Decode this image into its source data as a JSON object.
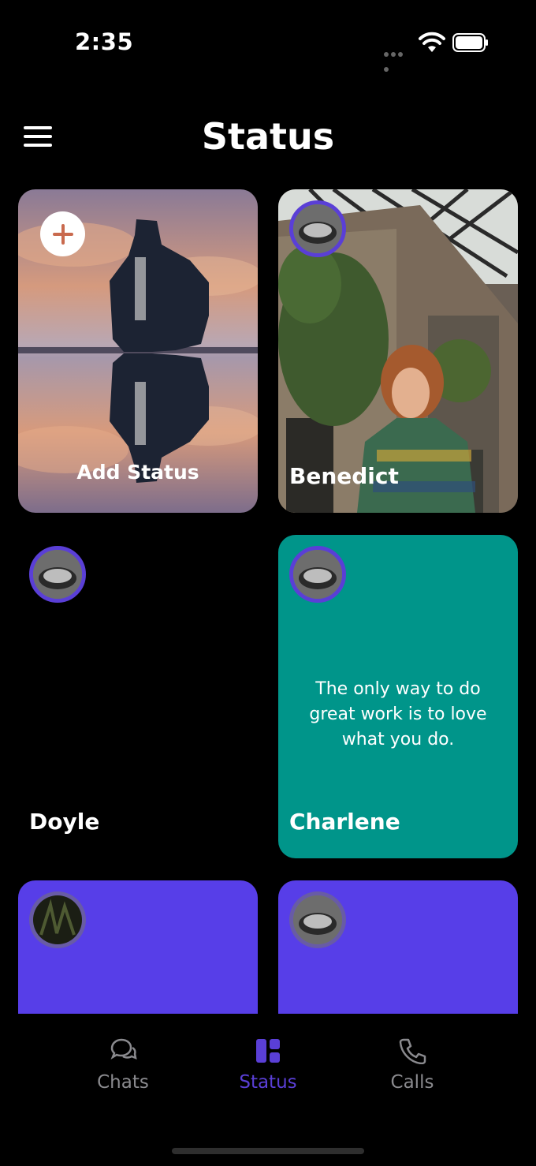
{
  "status_bar": {
    "time": "2:35"
  },
  "header": {
    "title": "Status"
  },
  "cards": [
    {
      "label": "Add Status"
    },
    {
      "label": "Benedict"
    },
    {
      "label": "Doyle"
    },
    {
      "label": "Charlene",
      "text": "The only way to do great work is to love what you do."
    },
    {
      "label": ""
    },
    {
      "label": ""
    }
  ],
  "colors": {
    "accent": "#5a3fd6",
    "teal": "#00958a",
    "purple": "#573ee8"
  },
  "tabs": [
    {
      "label": "Chats",
      "icon": "chat-bubbles-icon"
    },
    {
      "label": "Status",
      "icon": "grid-icon"
    },
    {
      "label": "Calls",
      "icon": "phone-icon"
    }
  ],
  "active_tab": "Status"
}
